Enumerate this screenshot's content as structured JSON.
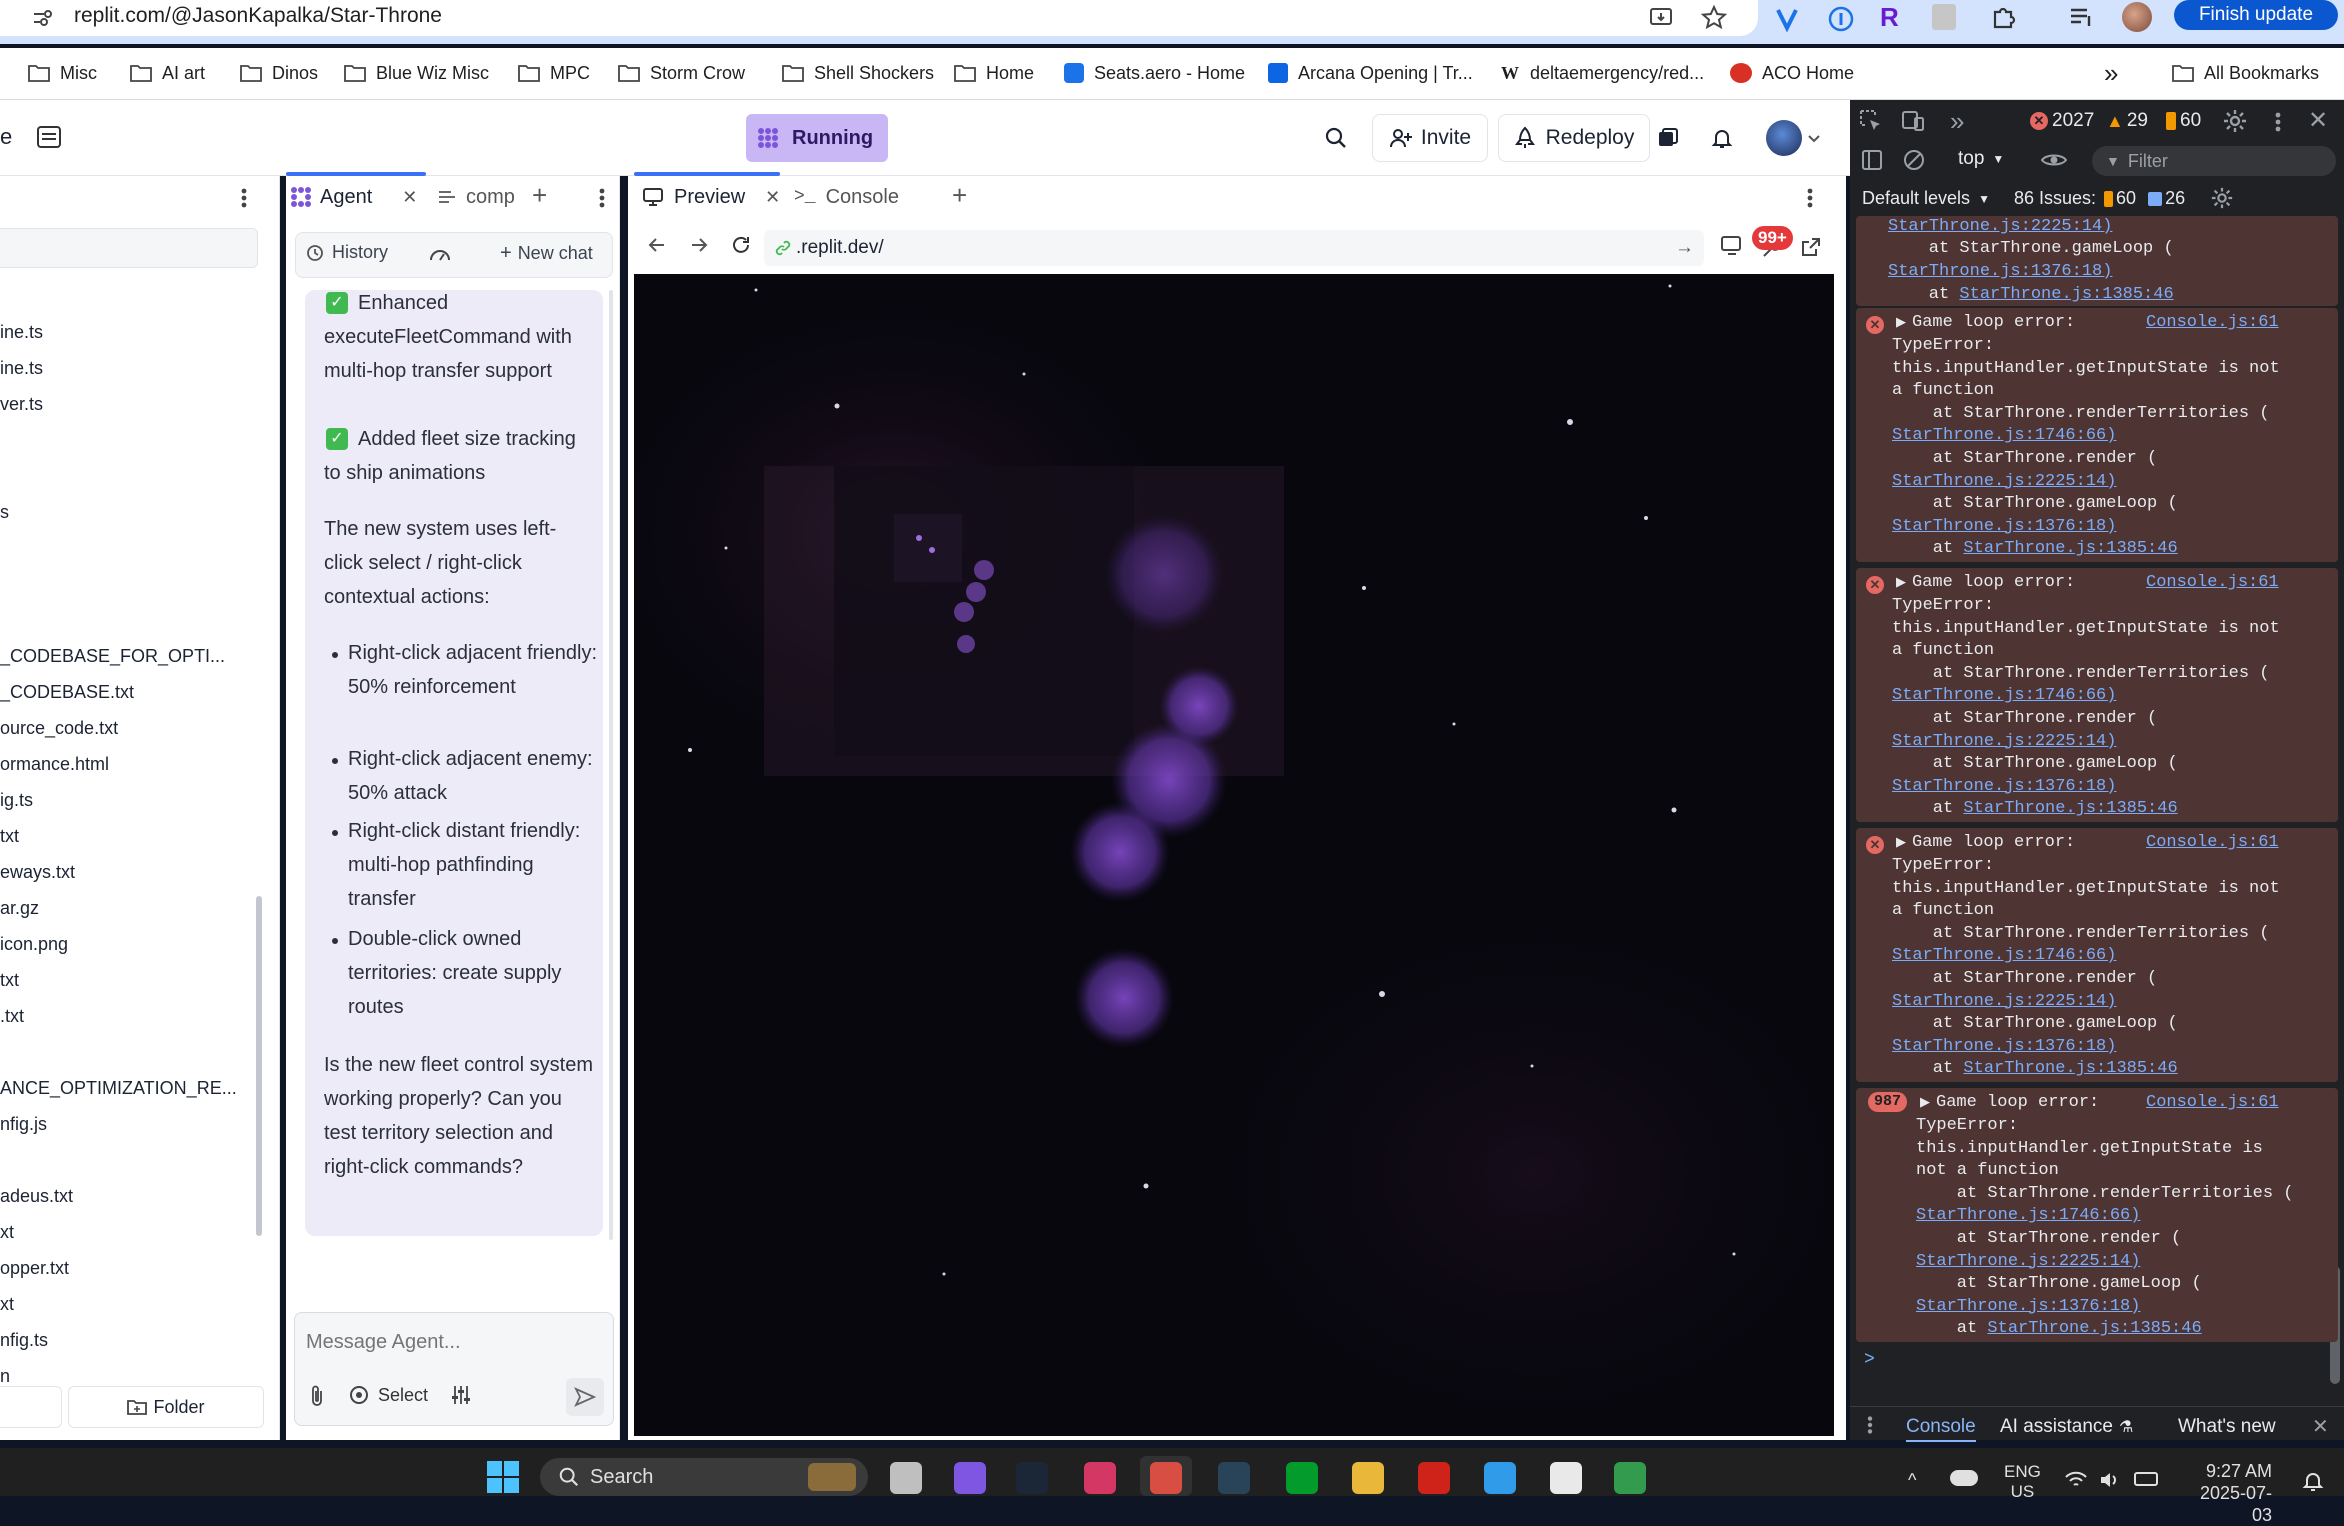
{
  "browser": {
    "url": "replit.com/@JasonKapalka/Star-Throne",
    "finish_update": "Finish update",
    "bookmarks": [
      "Misc",
      "AI art",
      "Dinos",
      "Blue Wiz Misc",
      "MPC",
      "Storm Crow",
      "Shell Shockers",
      "Home",
      "Seats.aero - Home",
      "Arcana Opening | Tr...",
      "deltaemergency/red...",
      "ACO Home"
    ],
    "all_bookmarks": "All Bookmarks",
    "more": "»"
  },
  "replit": {
    "left_tab_fragment": "e",
    "running": "Running",
    "invite": "Invite",
    "redeploy": "Redeploy"
  },
  "files": {
    "items": [
      "ine.ts",
      "ine.ts",
      "ver.ts",
      "s",
      "_CODEBASE_FOR_OPTI...",
      "_CODEBASE.txt",
      "ource_code.txt",
      "ormance.html",
      "ig.ts",
      "txt",
      "eways.txt",
      "ar.gz",
      "icon.png",
      "txt",
      ".txt",
      "ANCE_OPTIMIZATION_RE...",
      "nfig.js",
      "adeus.txt",
      "xt",
      "opper.txt",
      "xt",
      "nfig.ts",
      "n"
    ],
    "folder_button": "Folder"
  },
  "agent": {
    "tab_label": "Agent",
    "tab2_label": "comp",
    "history": "History",
    "new_chat": "New chat",
    "check1": "Enhanced executeFleetCommand with multi-hop transfer support",
    "check2": "Added fleet size tracking to ship animations",
    "para": "The new system uses left-click select / right-click contextual actions:",
    "bullets": [
      "Right-click adjacent friendly: 50% reinforcement",
      "Right-click adjacent enemy: 50% attack",
      "Right-click distant friendly: multi-hop pathfinding transfer",
      "Double-click owned territories: create supply routes"
    ],
    "question": "Is the new fleet control system working properly? Can you test territory selection and right-click commands?",
    "input_placeholder": "Message Agent...",
    "select_label": "Select"
  },
  "preview": {
    "tab_preview": "Preview",
    "tab_console": "Console",
    "url": ".replit.dev/",
    "badge": "99+"
  },
  "devtools": {
    "errors": "2027",
    "warnings": "29",
    "info": "60",
    "context": "top",
    "filter_placeholder": "Filter",
    "levels": "Default levels",
    "issues_label": "86 Issues:",
    "issues_warn": "60",
    "issues_info": "26",
    "top_partial": [
      "StarThrone.js:2225:14)",
      "    at StarThrone.gameLoop (",
      "StarThrone.js:1376:18)",
      "    at StarThrone.js:1385:46"
    ],
    "error_title": "Game loop error:",
    "error_source": "Console.js:61",
    "error_lines": [
      "TypeError:",
      "this.inputHandler.getInputState is not",
      "a function",
      "    at StarThrone.renderTerritories (",
      "StarThrone.js:1746:66)",
      "    at StarThrone.render (",
      "StarThrone.js:2225:14)",
      "    at StarThrone.gameLoop (",
      "StarThrone.js:1376:18)",
      "    at StarThrone.js:1385:46"
    ],
    "last_count": "987",
    "last_lines": [
      "TypeError:",
      "this.inputHandler.getInputState is",
      "not a function",
      "    at StarThrone.renderTerritories (",
      "StarThrone.js:1746:66)",
      "    at StarThrone.render (",
      "StarThrone.js:2225:14)",
      "    at StarThrone.gameLoop (",
      "StarThrone.js:1376:18)",
      "    at StarThrone.js:1385:46"
    ],
    "prompt": ">",
    "bottom_tabs": [
      "Console",
      "AI assistance",
      "What's new"
    ]
  },
  "taskbar": {
    "search": "Search",
    "lang": "ENG",
    "lang2": "US",
    "time": "9:27 AM",
    "date": "2025-07-03"
  },
  "colors": {
    "accent_purple": "#c9b6f5",
    "error_bg": "#4e3534",
    "error_red": "#e46962"
  }
}
